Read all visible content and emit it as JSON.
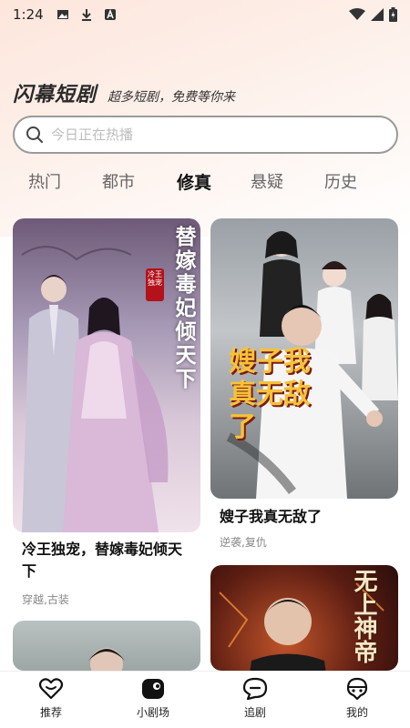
{
  "status_bar": {
    "time": "1:24",
    "icons": [
      "image-icon",
      "download-icon",
      "a-icon",
      "wifi-icon",
      "signal-icon",
      "battery-icon"
    ]
  },
  "header": {
    "title": "闪幕短剧",
    "slogan": "超多短剧，免费等你来"
  },
  "search": {
    "placeholder": "今日正在热播"
  },
  "tabs": [
    {
      "label": "热门",
      "active": false
    },
    {
      "label": "都市",
      "active": false
    },
    {
      "label": "修真",
      "active": true
    },
    {
      "label": "悬疑",
      "active": false
    },
    {
      "label": "历史",
      "active": false
    }
  ],
  "dramas": [
    {
      "poster_text": "替嫁毒妃倾天下",
      "poster_badge": "冷王独宠",
      "title": "冷王独宠，替嫁毒妃倾天下",
      "tags": "穿越,古装"
    },
    {
      "poster_text": "嫂子我真无敌了",
      "title": "嫂子我真无敌了",
      "tags": "逆袭,复仇"
    },
    {
      "poster_text": "无上神帝"
    },
    {
      "poster_text": ""
    }
  ],
  "bottom_nav": [
    {
      "label": "推荐",
      "icon": "heart-chat-icon"
    },
    {
      "label": "小剧场",
      "icon": "theater-icon"
    },
    {
      "label": "追剧",
      "icon": "follow-chat-icon"
    },
    {
      "label": "我的",
      "icon": "profile-icon"
    }
  ],
  "colors": {
    "accent": "#ff8a2a",
    "text_primary": "#111111",
    "text_secondary": "#888888",
    "search_border": "#9a9a9a"
  }
}
